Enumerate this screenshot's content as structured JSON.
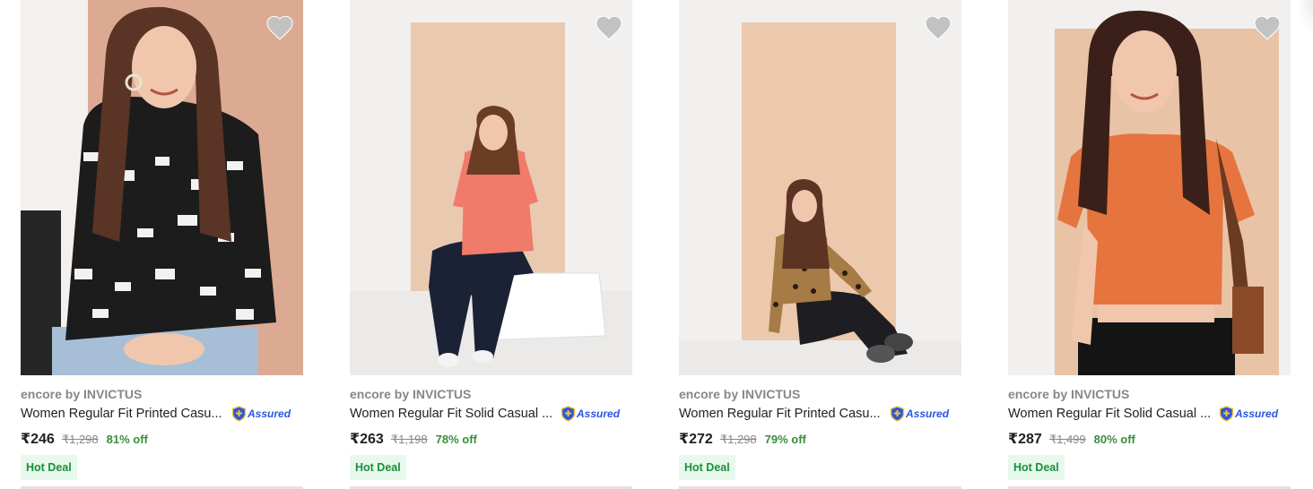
{
  "products": [
    {
      "brand": "encore by INVICTUS",
      "title": "Women Regular Fit Printed Casu...",
      "assured_label": "Assured",
      "price": "₹246",
      "mrp": "₹1,298",
      "discount": "81% off",
      "badge": "Hot Deal",
      "image_desc": "houndstooth-print-shirt",
      "colors": {
        "bg": "#dba88f",
        "wall": "#e9c2ab",
        "shirt": "#1d1d1d",
        "hair": "#5a3424",
        "pants": "#a9c2d8"
      }
    },
    {
      "brand": "encore by INVICTUS",
      "title": "Women Regular Fit Solid Casual ...",
      "assured_label": "Assured",
      "price": "₹263",
      "mrp": "₹1,198",
      "discount": "78% off",
      "badge": "Hot Deal",
      "image_desc": "coral-solid-shirt",
      "colors": {
        "bg": "#f1f0ee",
        "wall": "#e8c9b0",
        "shirt": "#f07b6a",
        "hair": "#6b3d24",
        "pants": "#1c2236"
      }
    },
    {
      "brand": "encore by INVICTUS",
      "title": "Women Regular Fit Printed Casu...",
      "assured_label": "Assured",
      "price": "₹272",
      "mrp": "₹1,298",
      "discount": "79% off",
      "badge": "Hot Deal",
      "image_desc": "leopard-print-shirt",
      "colors": {
        "bg": "#f1f0ee",
        "wall": "#ecc8ad",
        "shirt": "#a67b45",
        "hair": "#5c3424",
        "pants": "#1e1e22"
      }
    },
    {
      "brand": "encore by INVICTUS",
      "title": "Women Regular Fit Solid Casual ...",
      "assured_label": "Assured",
      "price": "₹287",
      "mrp": "₹1,499",
      "discount": "80% off",
      "badge": "Hot Deal",
      "image_desc": "orange-crop-shirt",
      "colors": {
        "bg": "#f1f0ee",
        "wall": "#e8c3a6",
        "shirt": "#e6743e",
        "hair": "#3b2019",
        "pants": "#141414"
      }
    }
  ],
  "icons": {
    "wishlist": "heart-icon",
    "assured": "shield-plus-icon"
  },
  "accent": {
    "discount_green": "#388e3c",
    "assured_blue": "#2a55e5",
    "badge_bg": "#e7f8ec"
  }
}
